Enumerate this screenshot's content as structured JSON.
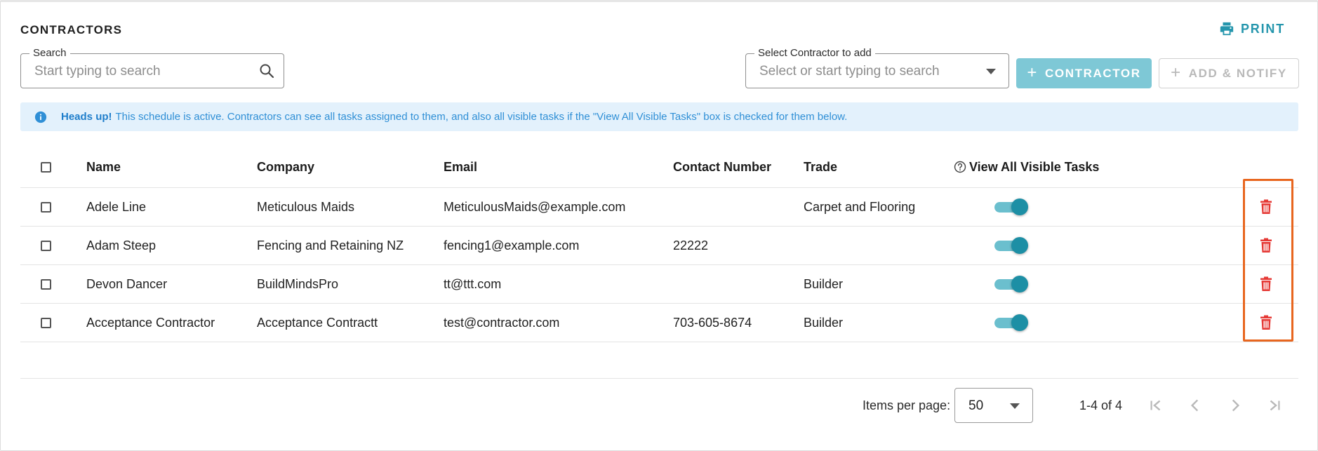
{
  "header": {
    "title": "CONTRACTORS",
    "print_label": "PRINT"
  },
  "search": {
    "legend": "Search",
    "placeholder": "Start typing to search"
  },
  "contractor_select": {
    "legend": "Select Contractor to add",
    "placeholder": "Select or start typing to search"
  },
  "buttons": {
    "add_contractor": "CONTRACTOR",
    "add_notify": "ADD & NOTIFY"
  },
  "alert": {
    "strong": "Heads up!",
    "message": "This schedule is active. Contractors can see all tasks assigned to them, and also all visible tasks if the \"View All Visible Tasks\" box is checked for them below."
  },
  "table": {
    "columns": {
      "name": "Name",
      "company": "Company",
      "email": "Email",
      "contact": "Contact Number",
      "trade": "Trade",
      "view_all": "View All Visible Tasks"
    },
    "rows": [
      {
        "name": "Adele Line",
        "company": "Meticulous Maids",
        "email": "MeticulousMaids@example.com",
        "contact": "",
        "trade": "Carpet and Flooring",
        "view_all": true
      },
      {
        "name": "Adam Steep",
        "company": "Fencing and Retaining NZ",
        "email": "fencing1@example.com",
        "contact": "22222",
        "trade": "",
        "view_all": true
      },
      {
        "name": "Devon Dancer",
        "company": "BuildMindsPro",
        "email": "tt@ttt.com",
        "contact": "",
        "trade": "Builder",
        "view_all": true
      },
      {
        "name": "Acceptance Contractor",
        "company": "Acceptance Contractt",
        "email": "test@contractor.com",
        "contact": "703-605-8674",
        "trade": "Builder",
        "view_all": true
      }
    ]
  },
  "paginator": {
    "items_per_page_label": "Items per page:",
    "items_per_page_value": "50",
    "range_label": "1-4 of 4"
  },
  "colors": {
    "accent": "#2596ad",
    "toggle_on": "#1d8fa5",
    "delete": "#e53935",
    "highlight": "#e8661f",
    "alert_bg": "#e3f1fc"
  }
}
